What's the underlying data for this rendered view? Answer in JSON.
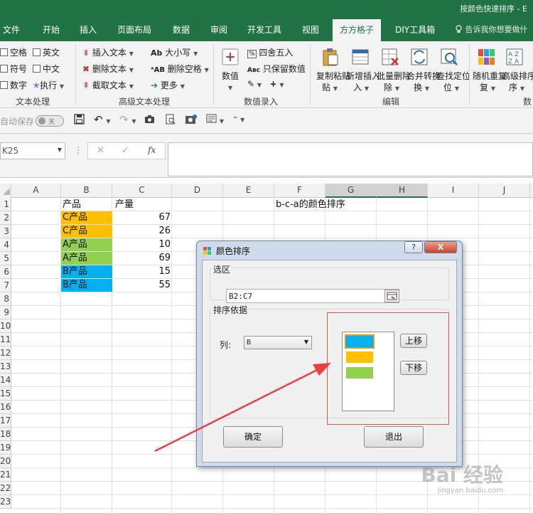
{
  "window": {
    "title": "按颜色快速排序 - E"
  },
  "tabs": [
    {
      "label": "文件"
    },
    {
      "label": "开始"
    },
    {
      "label": "插入"
    },
    {
      "label": "页面布局"
    },
    {
      "label": "数据"
    },
    {
      "label": "审阅"
    },
    {
      "label": "开发工具"
    },
    {
      "label": "视图"
    },
    {
      "label": "方方格子"
    },
    {
      "label": "DIY工具箱"
    }
  ],
  "tell_me": "告诉我你想要做什",
  "ribbon": {
    "text_process": {
      "space": "空格",
      "english": "英文",
      "symbol": "符号",
      "chinese": "中文",
      "number": "数字",
      "execute": "执行",
      "group_label": "文本处理"
    },
    "advanced_text": {
      "insert_text": "插入文本",
      "delete_text": "删除文本",
      "cut_text": "截取文本",
      "case": "大小写",
      "delete_space": "删除空格",
      "more": "更多",
      "group_label": "高级文本处理"
    },
    "numeric": {
      "value": "数值",
      "round": "四舍五入",
      "keep_value": "只保留数值",
      "group_label": "数值录入"
    },
    "edit": {
      "copy_paste": "复制粘贴",
      "add_insert": "新增插入",
      "batch_delete": "批量删除",
      "merge_convert": "合并转换",
      "find_locate": "查找定位",
      "group_label": "编辑"
    },
    "extra": {
      "random_repeat": "随机重复",
      "advanced_sort": "高级排序",
      "group_label_partial": "数"
    }
  },
  "qat": {
    "autosave": "自动保存",
    "toggle_state": "关"
  },
  "formula_bar": {
    "name_box": "K25",
    "fx": "fx"
  },
  "grid": {
    "columns": [
      "A",
      "B",
      "C",
      "D",
      "E",
      "F",
      "G",
      "H",
      "I",
      "J"
    ],
    "selected_columns": [
      "G",
      "H"
    ],
    "rows": [
      "1",
      "2",
      "3",
      "4",
      "5",
      "6",
      "7",
      "8",
      "9",
      "10",
      "11",
      "12",
      "13",
      "14",
      "15",
      "16",
      "17",
      "18",
      "19",
      "20",
      "21",
      "22",
      "23"
    ],
    "headers": {
      "b1": "产品",
      "c1": "产量"
    },
    "data": [
      {
        "product": "C产品",
        "qty": "67",
        "color": "#ffc000"
      },
      {
        "product": "C产品",
        "qty": "26",
        "color": "#ffc000"
      },
      {
        "product": "A产品",
        "qty": "10",
        "color": "#92d050"
      },
      {
        "product": "A产品",
        "qty": "69",
        "color": "#92d050"
      },
      {
        "product": "B产品",
        "qty": "15",
        "color": "#00b0f0"
      },
      {
        "product": "B产品",
        "qty": "55",
        "color": "#00b0f0"
      }
    ],
    "note_f1": "b-c-a的颜色排序"
  },
  "dialog": {
    "title": "颜色排序",
    "help_btn": "?",
    "close_btn": "X",
    "selection_label": "选区",
    "range_value": "B2:C7",
    "sort_basis_label": "排序依据",
    "column_label": "列:",
    "column_value": "B",
    "color_list": [
      "#00b0f0",
      "#ffc000",
      "#92d050"
    ],
    "move_up": "上移",
    "move_down": "下移",
    "ok": "确定",
    "exit": "退出"
  },
  "annotation": {
    "highlight_color": "#e05050",
    "arrow_color": "#e84040"
  },
  "watermark": {
    "brand": "Bai 经验",
    "url": "jingyan.baidu.com"
  }
}
